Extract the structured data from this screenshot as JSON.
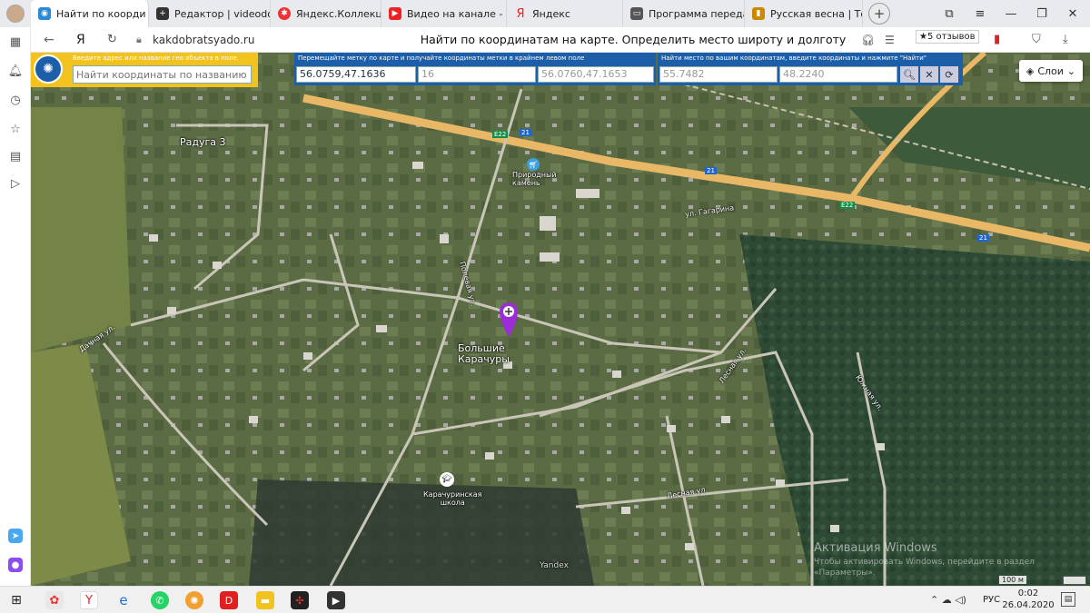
{
  "tabs": [
    {
      "title": "Найти по коорди",
      "color": "#2a8ad8",
      "active": true
    },
    {
      "title": "Редактор | videodoro",
      "color": "#333"
    },
    {
      "title": "Яндекс.Коллекции",
      "color": "#e33"
    },
    {
      "title": "Видео на канале - Yo",
      "color": "#e22"
    },
    {
      "title": "Яндекс",
      "color": "#e22"
    },
    {
      "title": "Программа передач",
      "color": "#555"
    },
    {
      "title": "Русская весна | Толь",
      "color": "#c80"
    }
  ],
  "tab_close": "✕",
  "new_tab": "+",
  "address": {
    "yandex_glyph": "Я",
    "url": "kakdobratsyado.ru",
    "page_title": "Найти по координатам на карте. Определить место широту и долготу",
    "reviews": "★5 отзывов"
  },
  "search": {
    "hint": "Введите адрес или название гео объекта в поле",
    "placeholder": "Найти координаты по названию"
  },
  "coord_panel": {
    "hint": "Перемещайте метку по карте и получайте координаты метки в крайнем левом поле",
    "marker_coords": "56.0759,47.1636",
    "zoom": "16",
    "corner_coords": "56.0760,47.1653"
  },
  "find_panel": {
    "hint": "Найти место по вашим координатам, введите координаты и нажмите \"Найти\"",
    "lat": "55.7482",
    "lon": "48.2240"
  },
  "layers_button": "Слои",
  "map_labels": {
    "raduga": "Радуга 3",
    "village": "Большие\nКарачуры",
    "school": "Карачуринская\nшкола",
    "store": "Природный\nкамень",
    "e22a": "E22",
    "e22b": "E22",
    "r21a": "21",
    "r21b": "21",
    "r21c": "21",
    "st_gagarina": "ул. Гагарина",
    "st_polevaya": "Полевая ул.",
    "st_dachnaya": "Дачная ул.",
    "st_lesnaya": "Лесная ул.",
    "st_yuzhnaya": "Южная ул.",
    "st_lesnaya2": "Лесная ул.",
    "yandex_mark": "Yandex"
  },
  "watermark": {
    "line1": "Активация Windows",
    "line2": "Чтобы активировать Windows, перейдите в раздел",
    "line3": "«Параметры»."
  },
  "scale": "100 м",
  "taskbar": {
    "lang": "РУС",
    "time": "0:02",
    "date": "26.04.2020"
  }
}
